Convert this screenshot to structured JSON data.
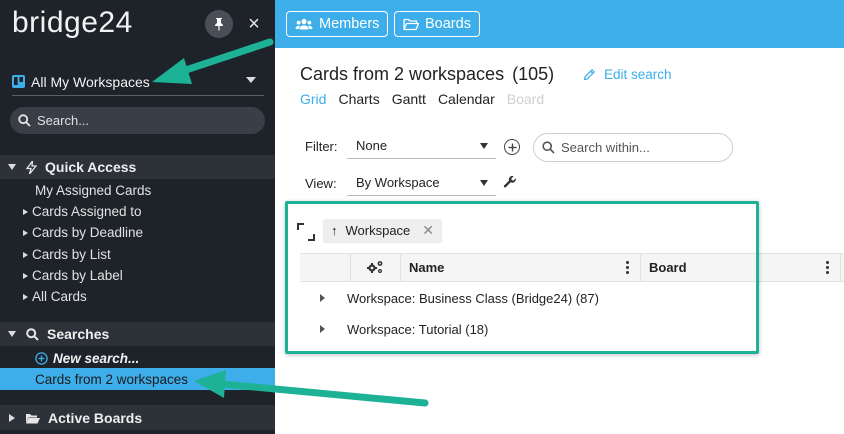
{
  "sidebar": {
    "logo": "bridge24",
    "close_glyph": "×",
    "workspace_select": {
      "label": "All My Workspaces",
      "icon": "trello-board-icon"
    },
    "search": {
      "placeholder": "Search..."
    },
    "quick_access": {
      "title": "Quick Access",
      "items": [
        {
          "label": "My Assigned Cards",
          "expandable": false
        },
        {
          "label": "Cards Assigned to",
          "expandable": true
        },
        {
          "label": "Cards by Deadline",
          "expandable": true
        },
        {
          "label": "Cards by List",
          "expandable": true
        },
        {
          "label": "Cards by Label",
          "expandable": true
        },
        {
          "label": "All Cards",
          "expandable": true
        }
      ]
    },
    "searches": {
      "title": "Searches",
      "new_search": "New search...",
      "items": [
        {
          "label": "Cards from 2 workspaces",
          "selected": true
        }
      ]
    },
    "active_boards": {
      "title": "Active Boards"
    }
  },
  "topbar": {
    "members_label": "Members",
    "boards_label": "Boards"
  },
  "main": {
    "title": "Cards from 2 workspaces",
    "count": "(105)",
    "edit_search": "Edit search",
    "tabs": [
      {
        "label": "Grid",
        "state": "active"
      },
      {
        "label": "Charts",
        "state": "normal"
      },
      {
        "label": "Gantt",
        "state": "normal"
      },
      {
        "label": "Calendar",
        "state": "normal"
      },
      {
        "label": "Board",
        "state": "disabled"
      }
    ],
    "filter": {
      "label": "Filter:",
      "value": "None"
    },
    "view": {
      "label": "View:",
      "value": "By Workspace"
    },
    "search_within": {
      "placeholder": "Search within..."
    },
    "grouping_chip": {
      "arrow": "↑",
      "label": "Workspace",
      "remove": "✕"
    },
    "columns": [
      "Name",
      "Board"
    ],
    "groups": [
      {
        "label": "Workspace: Business Class (Bridge24) (87)"
      },
      {
        "label": "Workspace: Tutorial (18)"
      }
    ]
  },
  "colors": {
    "accent": "#3daee9",
    "sidebar_bg": "#1e2229",
    "annotation": "#1db196"
  }
}
